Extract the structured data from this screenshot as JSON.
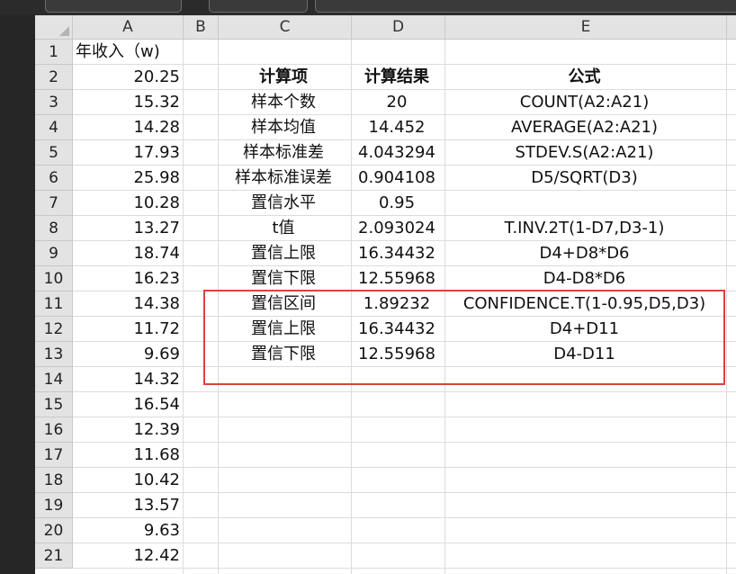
{
  "columns": [
    "A",
    "B",
    "C",
    "D",
    "E"
  ],
  "row_numbers": [
    "1",
    "2",
    "3",
    "4",
    "5",
    "6",
    "7",
    "8",
    "9",
    "10",
    "11",
    "12",
    "13",
    "14",
    "15",
    "16",
    "17",
    "18",
    "19",
    "20",
    "21"
  ],
  "column_a": {
    "header": "年收入（w)",
    "values": [
      "20.25",
      "15.32",
      "14.28",
      "17.93",
      "25.98",
      "10.28",
      "13.27",
      "18.74",
      "16.23",
      "14.38",
      "11.72",
      "9.69",
      "14.32",
      "16.54",
      "12.39",
      "11.68",
      "10.42",
      "13.57",
      "9.63",
      "12.42"
    ]
  },
  "table": {
    "headers": {
      "item": "计算项",
      "result": "计算结果",
      "formula": "公式"
    },
    "rows": [
      {
        "item": "样本个数",
        "result": "20",
        "formula": "COUNT(A2:A21)"
      },
      {
        "item": "样本均值",
        "result": "14.452",
        "formula": "AVERAGE(A2:A21)"
      },
      {
        "item": "样本标准差",
        "result": "4.043294",
        "formula": "STDEV.S(A2:A21)"
      },
      {
        "item": "样本标准误差",
        "result": "0.904108",
        "formula": "D5/SQRT(D3)"
      },
      {
        "item": "置信水平",
        "result": "0.95",
        "formula": ""
      },
      {
        "item": "t值",
        "result": "2.093024",
        "formula": "T.INV.2T(1-D7,D3-1)"
      },
      {
        "item": "置信上限",
        "result": "16.34432",
        "formula": "D4+D8*D6"
      },
      {
        "item": "置信下限",
        "result": "12.55968",
        "formula": "D4-D8*D6"
      },
      {
        "item": "置信区间",
        "result": "1.89232",
        "formula": "CONFIDENCE.T(1-0.95,D5,D3)"
      },
      {
        "item": "置信上限",
        "result": "16.34432",
        "formula": "D4+D11"
      },
      {
        "item": "置信下限",
        "result": "12.55968",
        "formula": "D4-D11"
      }
    ]
  },
  "colors": {
    "highlight_box": "#d9443a",
    "header_bg": "#e3e3e3",
    "gridline": "#dcdcdc"
  }
}
